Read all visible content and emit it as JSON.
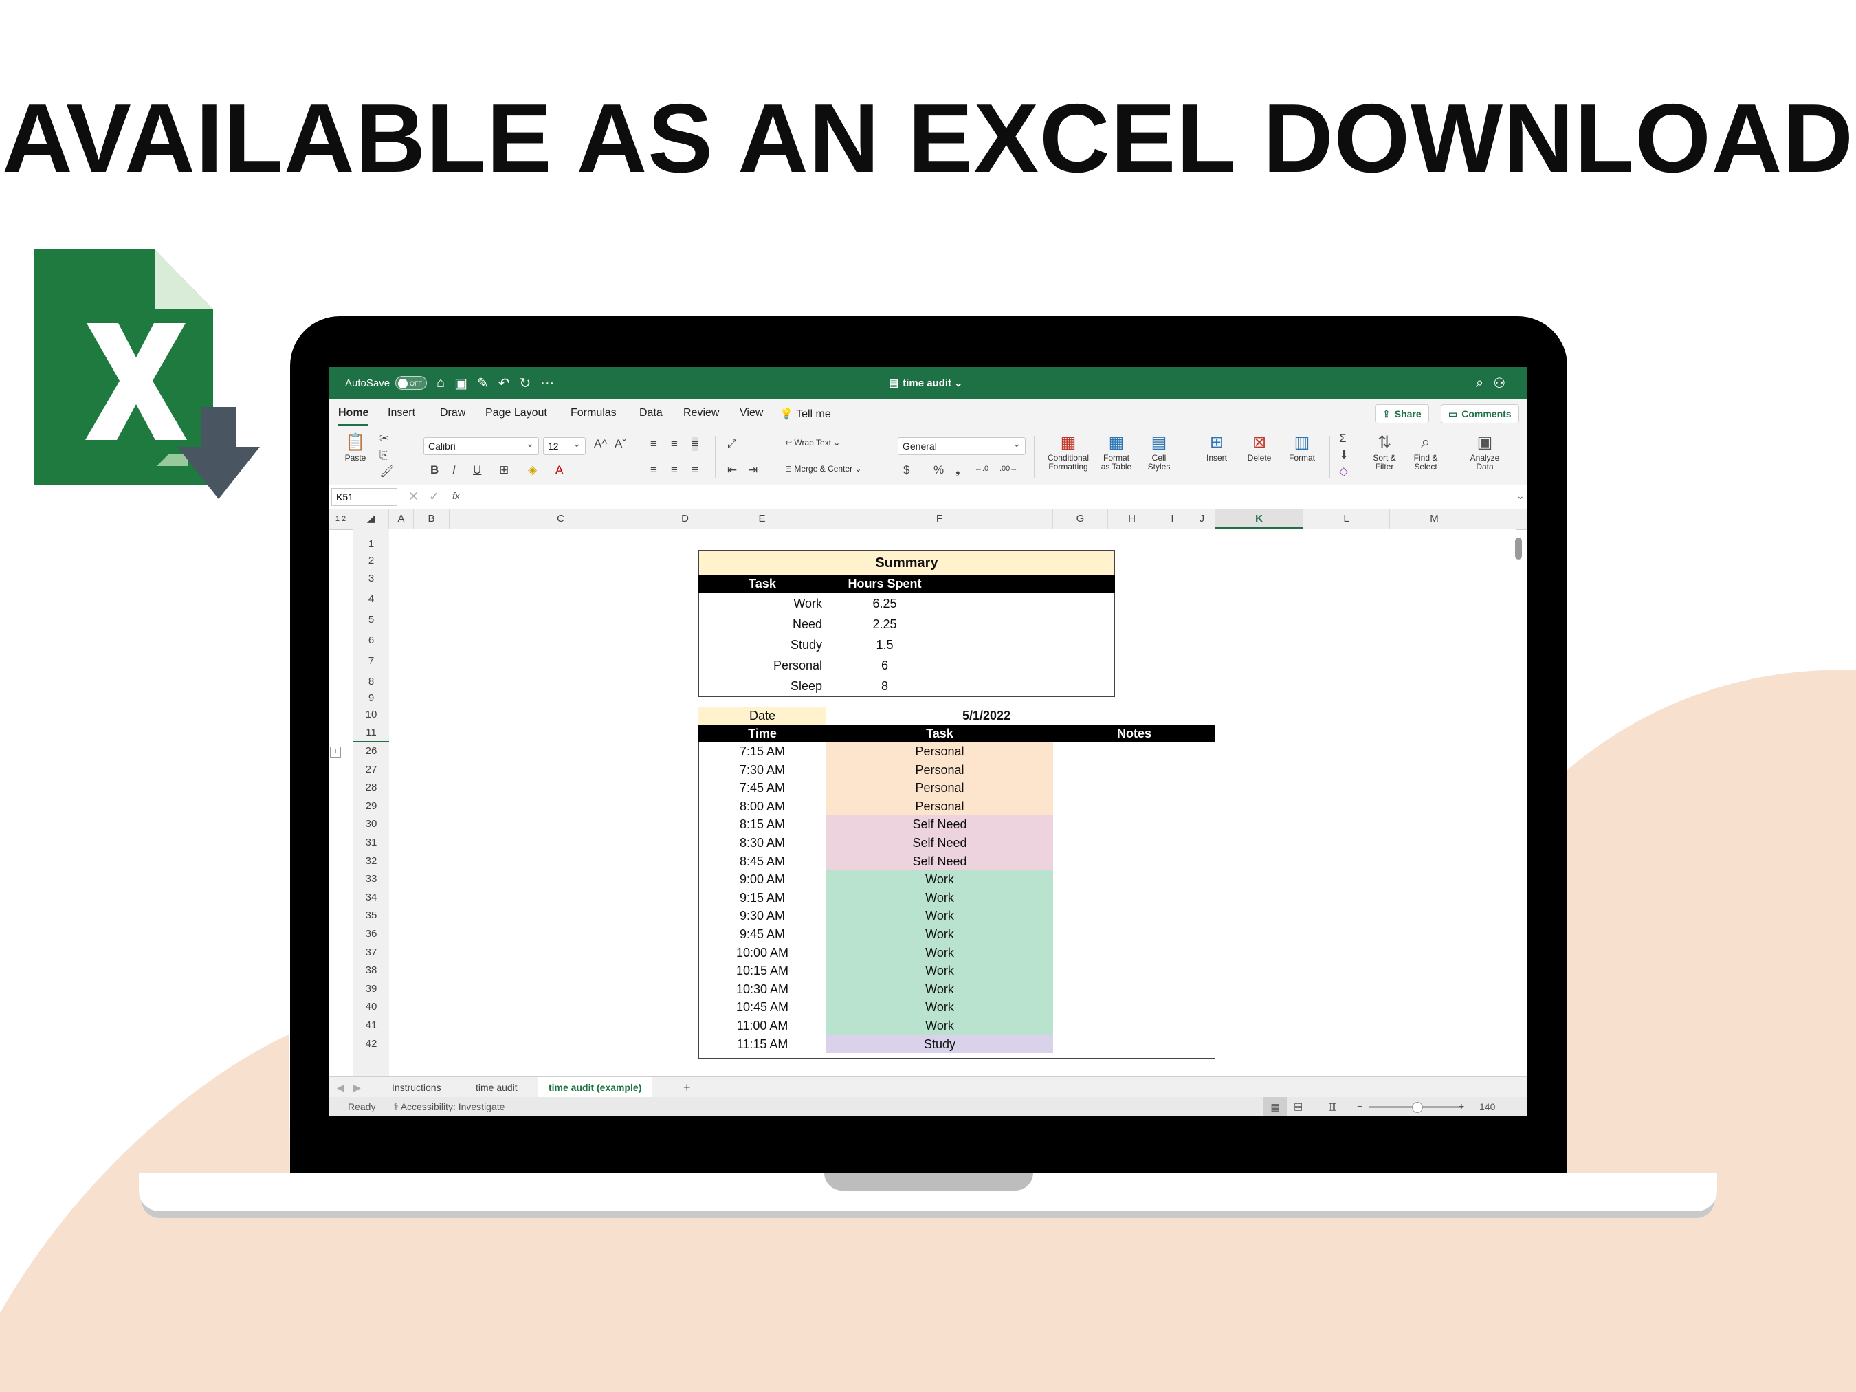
{
  "headline": "AVAILABLE AS AN EXCEL DOWNLOAD",
  "colors": {
    "excel_green": "#1e7145",
    "peach": "#f8e0cf",
    "summary_header": "#fff2cc",
    "personal": "#fde4cc",
    "self_need": "#ecd3dd",
    "work": "#b9e2cf",
    "study": "#d9d2ea"
  },
  "icons": {
    "logo": "excel-logo-icon",
    "download": "download-arrow-icon"
  },
  "titlebar": {
    "autosave": "AutoSave",
    "toggle": "OFF",
    "filename": "time audit",
    "more": "···"
  },
  "menu": {
    "items": [
      "Home",
      "Insert",
      "Draw",
      "Page Layout",
      "Formulas",
      "Data",
      "Review",
      "View"
    ],
    "tell_me": "Tell me",
    "share": "Share",
    "comments": "Comments"
  },
  "ribbon": {
    "paste": "Paste",
    "font_name": "Calibri",
    "font_size": "12",
    "bold": "B",
    "italic": "I",
    "underline": "U",
    "grow": "A^",
    "shrink": "Aˇ",
    "wrap_text": "Wrap Text",
    "merge_center": "Merge & Center",
    "number_format": "General",
    "currency": "$",
    "percent": "%",
    "comma": "❟",
    "inc_dec": "←.0",
    "dec_dec": ".00→",
    "conditional_1": "Conditional",
    "conditional_2": "Formatting",
    "format_table_1": "Format",
    "format_table_2": "as Table",
    "cell_styles_1": "Cell",
    "cell_styles_2": "Styles",
    "insert": "Insert",
    "delete": "Delete",
    "format": "Format",
    "sort_1": "Sort &",
    "sort_2": "Filter",
    "find_1": "Find &",
    "find_2": "Select",
    "analyze_1": "Analyze",
    "analyze_2": "Data"
  },
  "formula": {
    "namebox": "K51",
    "fx": "fx",
    "value": ""
  },
  "columns": [
    "A",
    "B",
    "C",
    "D",
    "E",
    "F",
    "G",
    "H",
    "I",
    "J",
    "K",
    "L",
    "M"
  ],
  "outline_levels": [
    "1",
    "2"
  ],
  "summary": {
    "title": "Summary",
    "headers": [
      "Task",
      "Hours Spent"
    ],
    "rows": [
      {
        "task": "Work",
        "hours": "6.25"
      },
      {
        "task": "Need",
        "hours": "2.25"
      },
      {
        "task": "Study",
        "hours": "1.5"
      },
      {
        "task": "Personal",
        "hours": "6"
      },
      {
        "task": "Sleep",
        "hours": "8"
      }
    ]
  },
  "log": {
    "date_label": "Date",
    "date_value": "5/1/2022",
    "headers": [
      "Time",
      "Task",
      "Notes"
    ],
    "rows": [
      {
        "row": "26",
        "time": "7:15 AM",
        "task": "Personal"
      },
      {
        "row": "27",
        "time": "7:30 AM",
        "task": "Personal"
      },
      {
        "row": "28",
        "time": "7:45 AM",
        "task": "Personal"
      },
      {
        "row": "29",
        "time": "8:00 AM",
        "task": "Personal"
      },
      {
        "row": "30",
        "time": "8:15 AM",
        "task": "Self Need"
      },
      {
        "row": "31",
        "time": "8:30 AM",
        "task": "Self Need"
      },
      {
        "row": "32",
        "time": "8:45 AM",
        "task": "Self Need"
      },
      {
        "row": "33",
        "time": "9:00 AM",
        "task": "Work"
      },
      {
        "row": "34",
        "time": "9:15 AM",
        "task": "Work"
      },
      {
        "row": "35",
        "time": "9:30 AM",
        "task": "Work"
      },
      {
        "row": "36",
        "time": "9:45 AM",
        "task": "Work"
      },
      {
        "row": "37",
        "time": "10:00 AM",
        "task": "Work"
      },
      {
        "row": "38",
        "time": "10:15 AM",
        "task": "Work"
      },
      {
        "row": "39",
        "time": "10:30 AM",
        "task": "Work"
      },
      {
        "row": "40",
        "time": "10:45 AM",
        "task": "Work"
      },
      {
        "row": "41",
        "time": "11:00 AM",
        "task": "Work"
      },
      {
        "row": "42",
        "time": "11:15 AM",
        "task": "Study"
      }
    ]
  },
  "row_numbers_top": [
    "1",
    "2",
    "3",
    "4",
    "5",
    "6",
    "7",
    "8",
    "9",
    "10",
    "11"
  ],
  "sheets": [
    "Instructions",
    "time audit",
    "time audit (example)"
  ],
  "add_sheet": "+",
  "status": {
    "ready": "Ready",
    "accessibility": "Accessibility: Investigate",
    "zoom_minus": "−",
    "zoom_plus": "+",
    "zoom": "140"
  }
}
